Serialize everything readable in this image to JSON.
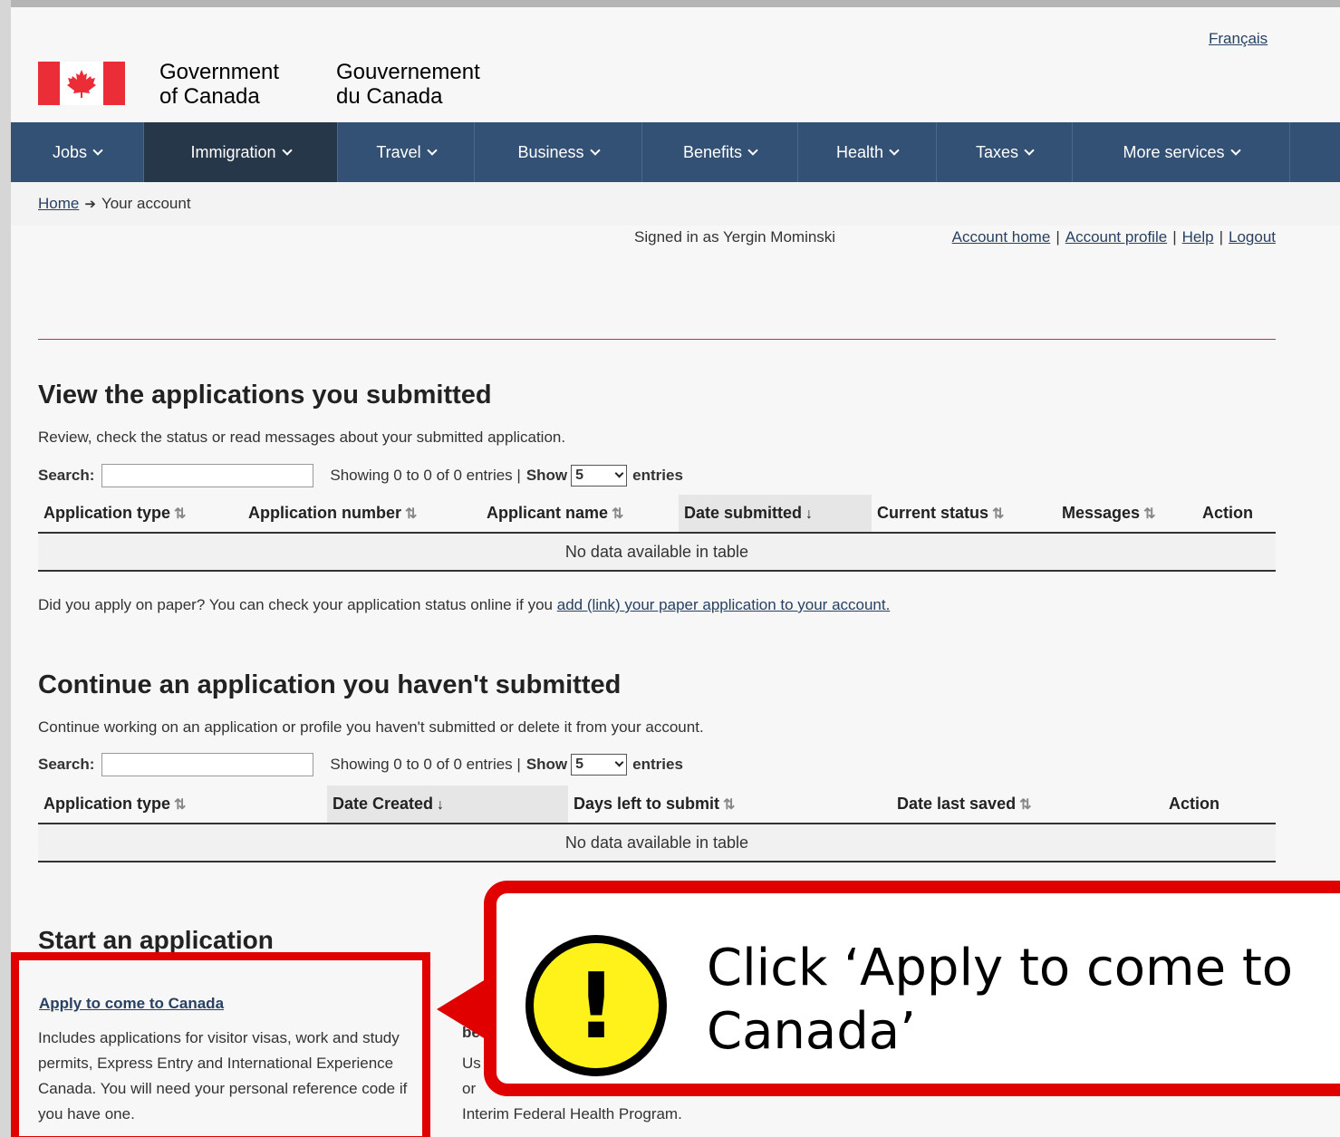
{
  "lang_link": "Français",
  "signature": {
    "en_line1": "Government",
    "en_line2": "of Canada",
    "fr_line1": "Gouvernement",
    "fr_line2": "du Canada"
  },
  "menu": {
    "items": [
      {
        "label": "Jobs"
      },
      {
        "label": "Immigration"
      },
      {
        "label": "Travel"
      },
      {
        "label": "Business"
      },
      {
        "label": "Benefits"
      },
      {
        "label": "Health"
      },
      {
        "label": "Taxes"
      },
      {
        "label": "More services"
      }
    ]
  },
  "breadcrumb": {
    "home": "Home",
    "current": "Your account"
  },
  "account": {
    "signed_in": "Signed in as Yergin Mominski",
    "links": {
      "home": "Account home",
      "profile": "Account profile",
      "help": "Help",
      "logout": "Logout"
    },
    "sep": "|"
  },
  "submitted": {
    "heading": "View the applications you submitted",
    "description": "Review, check the status or read messages about your submitted application.",
    "search_label": "Search:",
    "showing": "Showing 0 to 0 of 0 entries |",
    "show_label": "Show",
    "show_value": "5",
    "entries_label": "entries",
    "columns": [
      "Application type",
      "Application number",
      "Applicant name",
      "Date submitted",
      "Current status",
      "Messages",
      "Action"
    ],
    "empty": "No data available in table"
  },
  "paper": {
    "text": "Did you apply on paper?  You can check your application status online if you",
    "link": "add (link) your paper application to your account."
  },
  "unsubmitted": {
    "heading": "Continue an application you haven't submitted",
    "description": "Continue working on an application or profile you haven't submitted or delete it from your account.",
    "search_label": "Search:",
    "showing": "Showing 0 to 0 of 0 entries |",
    "show_label": "Show",
    "show_value": "5",
    "entries_label": "entries",
    "columns": [
      "Application type",
      "Date Created",
      "Days left to submit",
      "Date last saved",
      "Action"
    ],
    "empty": "No data available in table"
  },
  "start": {
    "heading": "Start an application",
    "apply_link": "Apply to come to Canada",
    "apply_desc": "Includes applications for visitor visas, work and study permits, Express Entry and International Experience Canada. You will need your personal reference code if you have one.",
    "col2_link_a": "K",
    "col2_link_b": "be",
    "col2_desc_a": "Us",
    "col2_desc_b": "or",
    "col2_desc_c": "Interim Federal Health Program."
  },
  "callout": {
    "icon": "exclamation-icon",
    "glyph": "!",
    "text": "Click ‘Apply to come to Canada’"
  },
  "colors": {
    "menu_bg": "#335075",
    "menu_active": "#26374a",
    "flag_red": "#eb2d37",
    "highlight_red": "#e00000",
    "warning_yellow": "#fff21a"
  }
}
